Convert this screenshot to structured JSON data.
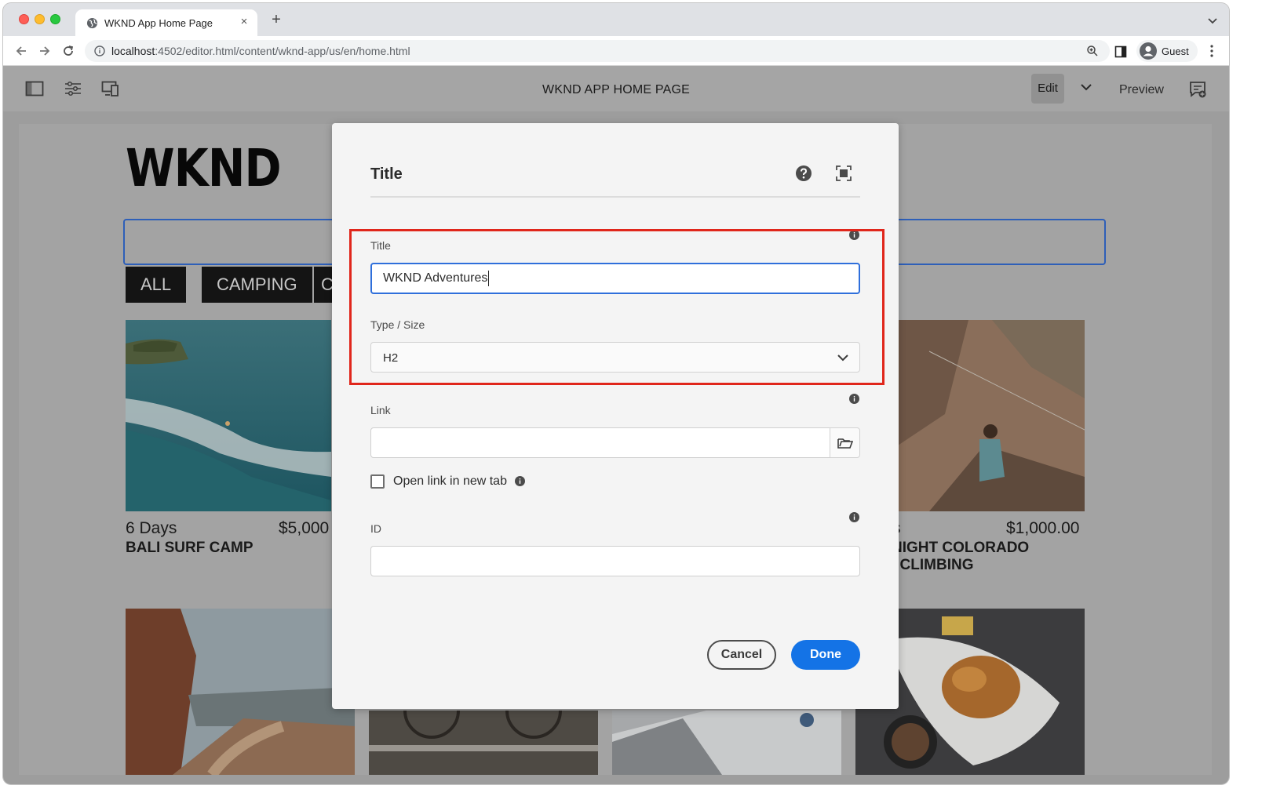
{
  "browser": {
    "tab_title": "WKND App Home Page",
    "url_host": "localhost",
    "url_path": ":4502/editor.html/content/wknd-app/us/en/home.html",
    "profile_label": "Guest"
  },
  "editor": {
    "page_title": "WKND APP HOME PAGE",
    "edit_label": "Edit",
    "preview_label": "Preview"
  },
  "site": {
    "logo": "WKND",
    "filters": [
      "ALL",
      "CAMPING",
      "C"
    ],
    "cards": [
      {
        "days": "6 Days",
        "price": "$5,000",
        "name": "BALI SURF CAMP"
      },
      {
        "days": "s",
        "price": "$1,000.00",
        "name_line1": "NIGHT COLORADO",
        "name_line2": ". CLIMBING"
      }
    ]
  },
  "dialog": {
    "title": "Title",
    "fields": {
      "title_label": "Title",
      "title_value": "WKND Adventures",
      "type_label": "Type / Size",
      "type_value": "H2",
      "link_label": "Link",
      "link_value": "",
      "new_tab_label": "Open link in new tab",
      "id_label": "ID",
      "id_value": ""
    },
    "cancel_label": "Cancel",
    "done_label": "Done"
  },
  "colors": {
    "accent": "#1473e6",
    "focus": "#2f6fdb",
    "highlight": "#e0261b"
  }
}
